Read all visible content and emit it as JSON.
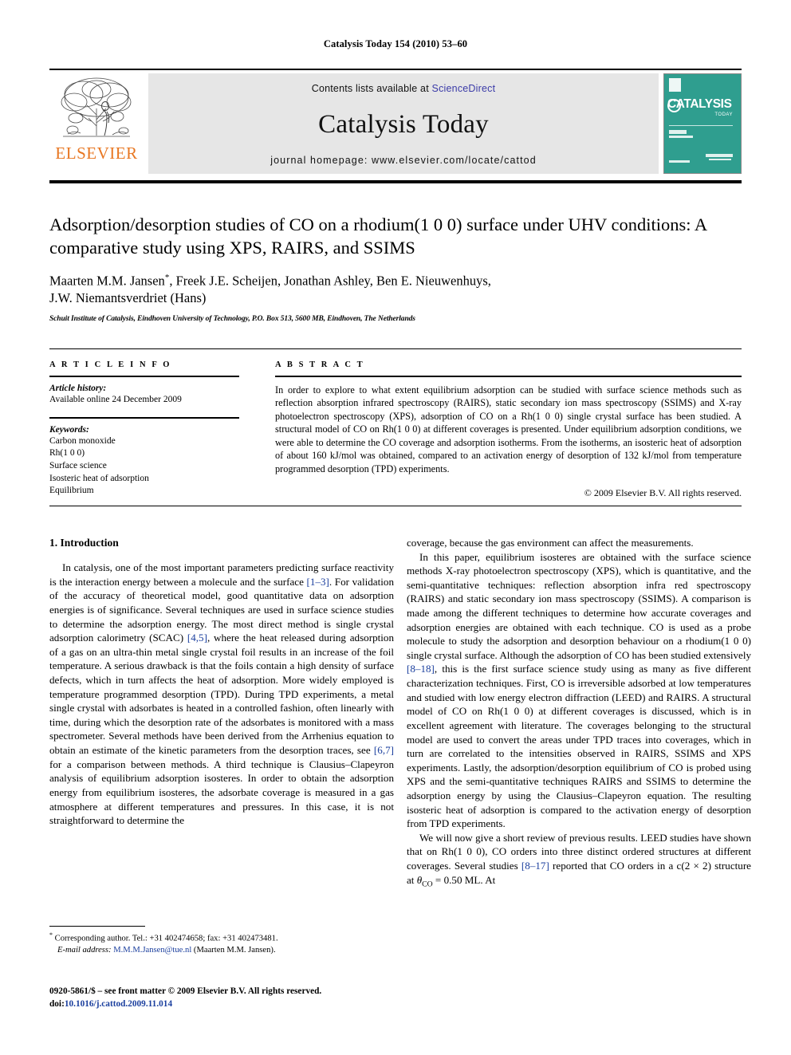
{
  "running_head": "Catalysis Today 154 (2010) 53–60",
  "masthead": {
    "publisher_name": "ELSEVIER",
    "contents_prefix": "Contents lists available at ",
    "sciencedirect": "ScienceDirect",
    "journal_title": "Catalysis Today",
    "homepage": "journal homepage: www.elsevier.com/locate/cattod",
    "cover": {
      "title_main": "CATALYSIS",
      "title_sub": "TODAY"
    },
    "colors": {
      "elsevier_orange": "#E87722",
      "link_blue": "#3b3ba8",
      "cover_teal": "#2f9e8f",
      "band_gray": "#e6e6e6"
    }
  },
  "article": {
    "title": "Adsorption/desorption studies of CO on a rhodium(1 0 0) surface under UHV conditions: A comparative study using XPS, RAIRS, and SSIMS",
    "authors_line1": "Maarten M.M. Jansen",
    "authors_line1_rest": ", Freek J.E. Scheijen, Jonathan Ashley, Ben E. Nieuwenhuys,",
    "authors_marker": "*",
    "authors_line2": "J.W. Niemantsverdriet (Hans)",
    "affiliation": "Schuit Institute of Catalysis, Eindhoven University of Technology, P.O. Box 513, 5600 MB, Eindhoven, The Netherlands"
  },
  "article_info": {
    "heading": "A R T I C L E   I N F O",
    "history_label": "Article history:",
    "history_value": "Available online 24 December 2009",
    "keywords_label": "Keywords:",
    "keywords": [
      "Carbon monoxide",
      "Rh(1 0 0)",
      "Surface science",
      "Isosteric heat of adsorption",
      "Equilibrium"
    ]
  },
  "abstract": {
    "heading": "A B S T R A C T",
    "text": "In order to explore to what extent equilibrium adsorption can be studied with surface science methods such as reflection absorption infrared spectroscopy (RAIRS), static secondary ion mass spectroscopy (SSIMS) and X-ray photoelectron spectroscopy (XPS), adsorption of CO on a Rh(1 0 0) single crystal surface has been studied. A structural model of CO on Rh(1 0 0) at different coverages is presented. Under equilibrium adsorption conditions, we were able to determine the CO coverage and adsorption isotherms. From the isotherms, an isosteric heat of adsorption of about 160 kJ/mol was obtained, compared to an activation energy of desorption of 132 kJ/mol from temperature programmed desorption (TPD) experiments.",
    "copyright": "© 2009 Elsevier B.V. All rights reserved."
  },
  "introduction": {
    "heading": "1. Introduction",
    "left_p1_a": "In catalysis, one of the most important parameters predicting surface reactivity is the interaction energy between a molecule and the surface ",
    "left_ref1": "[1–3]",
    "left_p1_b": ". For validation of the accuracy of theoretical model, good quantitative data on adsorption energies is of significance. Several techniques are used in surface science studies to determine the adsorption energy. The most direct method is single crystal adsorption calorimetry (SCAC) ",
    "left_ref2": "[4,5]",
    "left_p1_c": ", where the heat released during adsorption of a gas on an ultra-thin metal single crystal foil results in an increase of the foil temperature. A serious drawback is that the foils contain a high density of surface defects, which in turn affects the heat of adsorption. More widely employed is temperature programmed desorption (TPD). During TPD experiments, a metal single crystal with adsorbates is heated in a controlled fashion, often linearly with time, during which the desorption rate of the adsorbates is monitored with a mass spectrometer. Several methods have been derived from the Arrhenius equation to obtain an estimate of the kinetic parameters from the desorption traces, see ",
    "left_ref3": "[6,7]",
    "left_p1_d": " for a comparison between methods. A third technique is Clausius–Clapeyron analysis of equilibrium adsorption isosteres. In order to obtain the adsorption energy from equilibrium isosteres, the adsorbate coverage is measured in a gas atmosphere at different temperatures and pressures. In this case, it is not straightforward to determine the",
    "right_p0": "coverage, because the gas environment can affect the measurements.",
    "right_p1_a": "In this paper, equilibrium isosteres are obtained with the surface science methods X-ray photoelectron spectroscopy (XPS), which is quantitative, and the semi-quantitative techniques: reflection absorption infra red spectroscopy (RAIRS) and static secondary ion mass spectroscopy (SSIMS). A comparison is made among the different techniques to determine how accurate coverages and adsorption energies are obtained with each technique. CO is used as a probe molecule to study the adsorption and desorption behaviour on a rhodium(1 0 0) single crystal surface. Although the adsorption of CO has been studied extensively ",
    "right_ref1": "[8–18]",
    "right_p1_b": ", this is the first surface science study using as many as five different characterization techniques. First, CO is irreversible adsorbed at low temperatures and studied with low energy electron diffraction (LEED) and RAIRS. A structural model of CO on Rh(1 0 0) at different coverages is discussed, which is in excellent agreement with literature. The coverages belonging to the structural model are used to convert the areas under TPD traces into coverages, which in turn are correlated to the intensities observed in RAIRS, SSIMS and XPS experiments. Lastly, the adsorption/desorption equilibrium of CO is probed using XPS and the semi-quantitative techniques RAIRS and SSIMS to determine the adsorption energy by using the Clausius–Clapeyron equation. The resulting isosteric heat of adsorption is compared to the activation energy of desorption from TPD experiments.",
    "right_p2_a": "We will now give a short review of previous results. LEED studies have shown that on Rh(1 0 0), CO orders into three distinct ordered structures at different coverages. Several studies ",
    "right_ref2": "[8–17]",
    "right_p2_b": " reported that CO orders in a c(2 × 2) structure at ",
    "right_p2_theta": "θ",
    "right_p2_sub": "CO",
    "right_p2_c": " = 0.50 ML. At"
  },
  "footer": {
    "corresponding_marker": "*",
    "corresponding_text": " Corresponding author. Tel.: +31 402474658; fax: +31 402473481.",
    "email_label": "E-mail address:",
    "email": "M.M.M.Jansen@tue.nl",
    "email_suffix": " (Maarten M.M. Jansen).",
    "imprint_line1": "0920-5861/$ – see front matter © 2009 Elsevier B.V. All rights reserved.",
    "doi_label": "doi:",
    "doi_value": "10.1016/j.cattod.2009.11.014"
  }
}
